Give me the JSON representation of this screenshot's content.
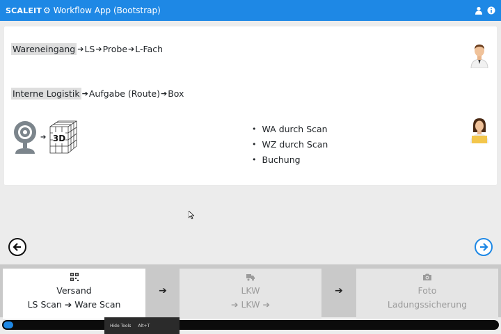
{
  "header": {
    "brand": "SCALEIT",
    "title": "Workflow App (Bootstrap)",
    "icons": [
      "user-icon",
      "info-icon"
    ]
  },
  "card": {
    "line1": {
      "highlight": "Wareneingang",
      "steps": [
        "LS",
        "Probe",
        "L-Fach"
      ]
    },
    "line2": {
      "highlight": "Interne Logistik",
      "steps": [
        "Aufgabe (Route)",
        "Box"
      ]
    },
    "bullets": [
      "WA durch Scan",
      "WZ durch Scan",
      "Buchung"
    ],
    "cube_label": "3D"
  },
  "steps": [
    {
      "icon": "qr-code-icon",
      "title": "Versand",
      "subtitle_a": "LS Scan",
      "subtitle_b": "Ware Scan",
      "active": true
    },
    {
      "icon": "truck-icon",
      "title": "LKW",
      "subtitle_a": "",
      "subtitle_b": "LKW",
      "active": false
    },
    {
      "icon": "camera-icon",
      "title": "Foto",
      "subtitle_a": "Ladungssicherung",
      "subtitle_b": "",
      "active": false
    }
  ],
  "progress": 0.02,
  "tooltip": {
    "label": "Hide Tools",
    "shortcut": "Alt+T"
  },
  "colors": {
    "primary": "#1e88e5"
  }
}
